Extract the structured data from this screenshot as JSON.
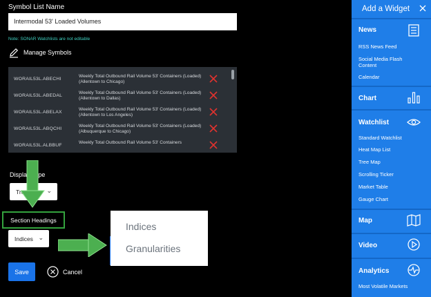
{
  "form": {
    "symbol_list_label": "Symbol List Name",
    "symbol_list_value": "Intermodal 53' Loaded Volumes",
    "note": "Note: SONAR Watchlists are not editable",
    "manage_symbols": "Manage Symbols",
    "display_type_label": "Display Type",
    "display_type_value": "Tree Map",
    "section_headings_label": "Section Headings",
    "section_headings_value": "Indices",
    "save": "Save",
    "cancel": "Cancel"
  },
  "symbols": [
    {
      "code": "WORAIL53L.ABECHI",
      "desc": "Weekly Total Outbound Rail Volume 53' Containers (Loaded) (Allentown to Chicago)"
    },
    {
      "code": "WORAIL53L.ABEDAL",
      "desc": "Weekly Total Outbound Rail Volume 53' Containers (Loaded) (Allentown to Dallas)"
    },
    {
      "code": "WORAIL53L.ABELAX",
      "desc": "Weekly Total Outbound Rail Volume 53' Containers (Loaded) (Allentown to Los Angeles)"
    },
    {
      "code": "WORAIL53L.ABQCHI",
      "desc": "Weekly Total Outbound Rail Volume 53' Containers (Loaded) (Albuquerque to Chicago)"
    },
    {
      "code": "WORAIL53L.ALBBUF",
      "desc": "Weekly Total Outbound Rail Volume 53' Containers"
    }
  ],
  "dropdown_options": [
    "Indices",
    "Granularities"
  ],
  "widget_panel": {
    "title": "Add a Widget",
    "categories": [
      {
        "name": "News",
        "icon": "newspaper-icon",
        "items": [
          "RSS News Feed",
          "Social Media Flash Content",
          "Calendar"
        ]
      },
      {
        "name": "Chart",
        "icon": "bar-chart-icon",
        "items": []
      },
      {
        "name": "Watchlist",
        "icon": "eye-icon",
        "items": [
          "Standard Watchlist",
          "Heat Map List",
          "Tree Map",
          "Scrolling Ticker",
          "Market Table",
          "Gauge Chart"
        ]
      },
      {
        "name": "Map",
        "icon": "map-icon",
        "items": []
      },
      {
        "name": "Video",
        "icon": "play-circle-icon",
        "items": []
      },
      {
        "name": "Analytics",
        "icon": "pulse-icon",
        "items": [
          "Most Volatile Markets"
        ]
      }
    ]
  },
  "colors": {
    "accent_blue": "#1a73e8",
    "panel_blue": "#1f7ee8",
    "annotation_green": "#4caf50",
    "delete_red": "#e0322f",
    "note_teal": "#3fd0c0"
  }
}
